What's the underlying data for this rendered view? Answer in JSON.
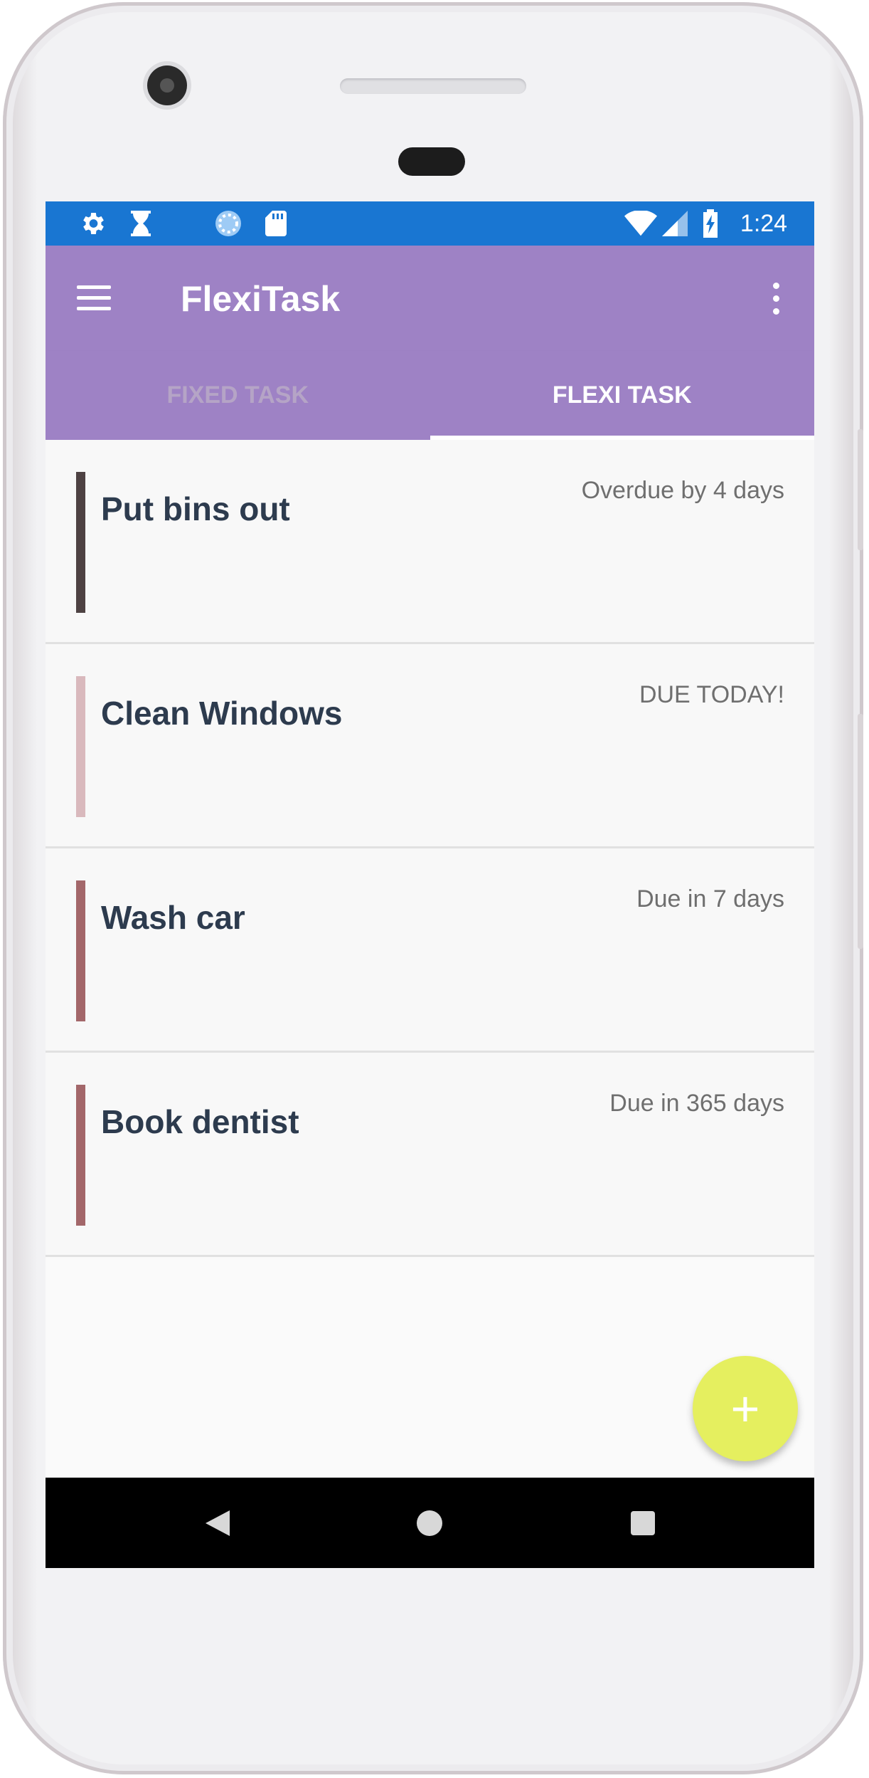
{
  "status_bar": {
    "time": "1:24",
    "left_icons": [
      "settings-icon",
      "hourglass-icon",
      "sync-icon",
      "sd-card-icon"
    ],
    "right_icons": [
      "wifi-icon",
      "signal-icon",
      "battery-charging-icon"
    ],
    "color": "#1976d2"
  },
  "app_bar": {
    "title": "FlexiTask",
    "color": "#9e82c5"
  },
  "tabs": [
    {
      "label": "FIXED TASK",
      "selected": false
    },
    {
      "label": "FLEXI TASK",
      "selected": true
    }
  ],
  "tasks": [
    {
      "title": "Put bins out",
      "status": "Overdue by 4 days",
      "bar_color": "#4e4243"
    },
    {
      "title": "Clean Windows",
      "status": "DUE TODAY!",
      "bar_color": "#d9b9bd"
    },
    {
      "title": "Wash car",
      "status": "Due in 7 days",
      "bar_color": "#a3676a"
    },
    {
      "title": "Book dentist",
      "status": "Due in 365 days",
      "bar_color": "#a3676a"
    }
  ],
  "fab": {
    "label": "+",
    "color": "#e5ef5f"
  },
  "nav_bar": {
    "buttons": [
      "back-icon",
      "home-icon",
      "recents-icon"
    ]
  }
}
